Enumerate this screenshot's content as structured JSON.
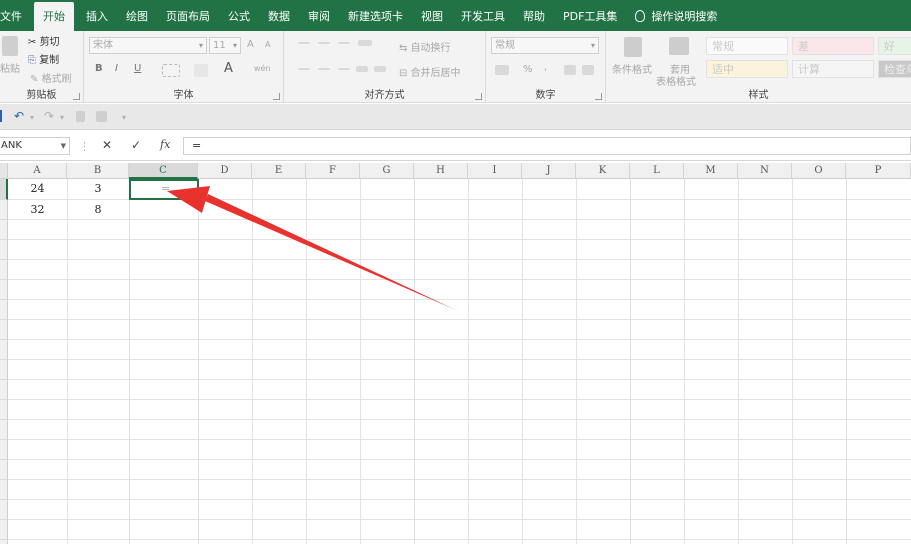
{
  "menu_tabs": [
    "文件",
    "开始",
    "插入",
    "绘图",
    "页面布局",
    "公式",
    "数据",
    "审阅",
    "新建选项卡",
    "视图",
    "开发工具",
    "帮助",
    "PDF工具集"
  ],
  "active_tab": "开始",
  "tell_me": "操作说明搜索",
  "ribbon": {
    "clipboard": {
      "label": "剪贴板",
      "paste": "粘贴",
      "cut": "剪切",
      "copy": "复制",
      "format_painter": "格式刷"
    },
    "font": {
      "label": "字体",
      "font_name": "宋体",
      "font_size": "11",
      "grow": "A",
      "shrink": "A",
      "bold": "B",
      "italic": "I",
      "underline": "U",
      "font_color": "A",
      "phonetic": "wén"
    },
    "alignment": {
      "label": "对齐方式",
      "wrap_text": "自动换行",
      "merge_center": "合并后居中"
    },
    "number": {
      "label": "数字",
      "format": "常规",
      "percent": "%",
      "comma": ","
    },
    "styles": {
      "label": "样式",
      "conditional_format": "条件格式",
      "format_as_table_1": "套用",
      "format_as_table_2": "表格格式",
      "cells": [
        "常规",
        "差",
        "好",
        "适中",
        "计算",
        "检查单"
      ],
      "bad_color": "#ffc7ce",
      "good_color": "#c6efce",
      "neutral_color": "#ffeb9c",
      "check_color": "#a5a5a5"
    }
  },
  "qat": {
    "undo": "↶",
    "redo": "↷"
  },
  "formula_bar": {
    "name_box": "ANK",
    "cancel": "✕",
    "enter": "✓",
    "fx": "fx",
    "formula": "="
  },
  "columns": [
    "A",
    "B",
    "C",
    "D",
    "E",
    "F",
    "G",
    "H",
    "I",
    "J",
    "K",
    "L",
    "M",
    "N",
    "O",
    "P"
  ],
  "selected_column": "C",
  "cells": {
    "A1": "24",
    "B1": "3",
    "A2": "32",
    "B2": "8"
  },
  "active_cell": {
    "ref": "C1",
    "content": "="
  },
  "annotation": {
    "color": "#e8322d"
  },
  "theme": {
    "excel_green": "#217346"
  }
}
